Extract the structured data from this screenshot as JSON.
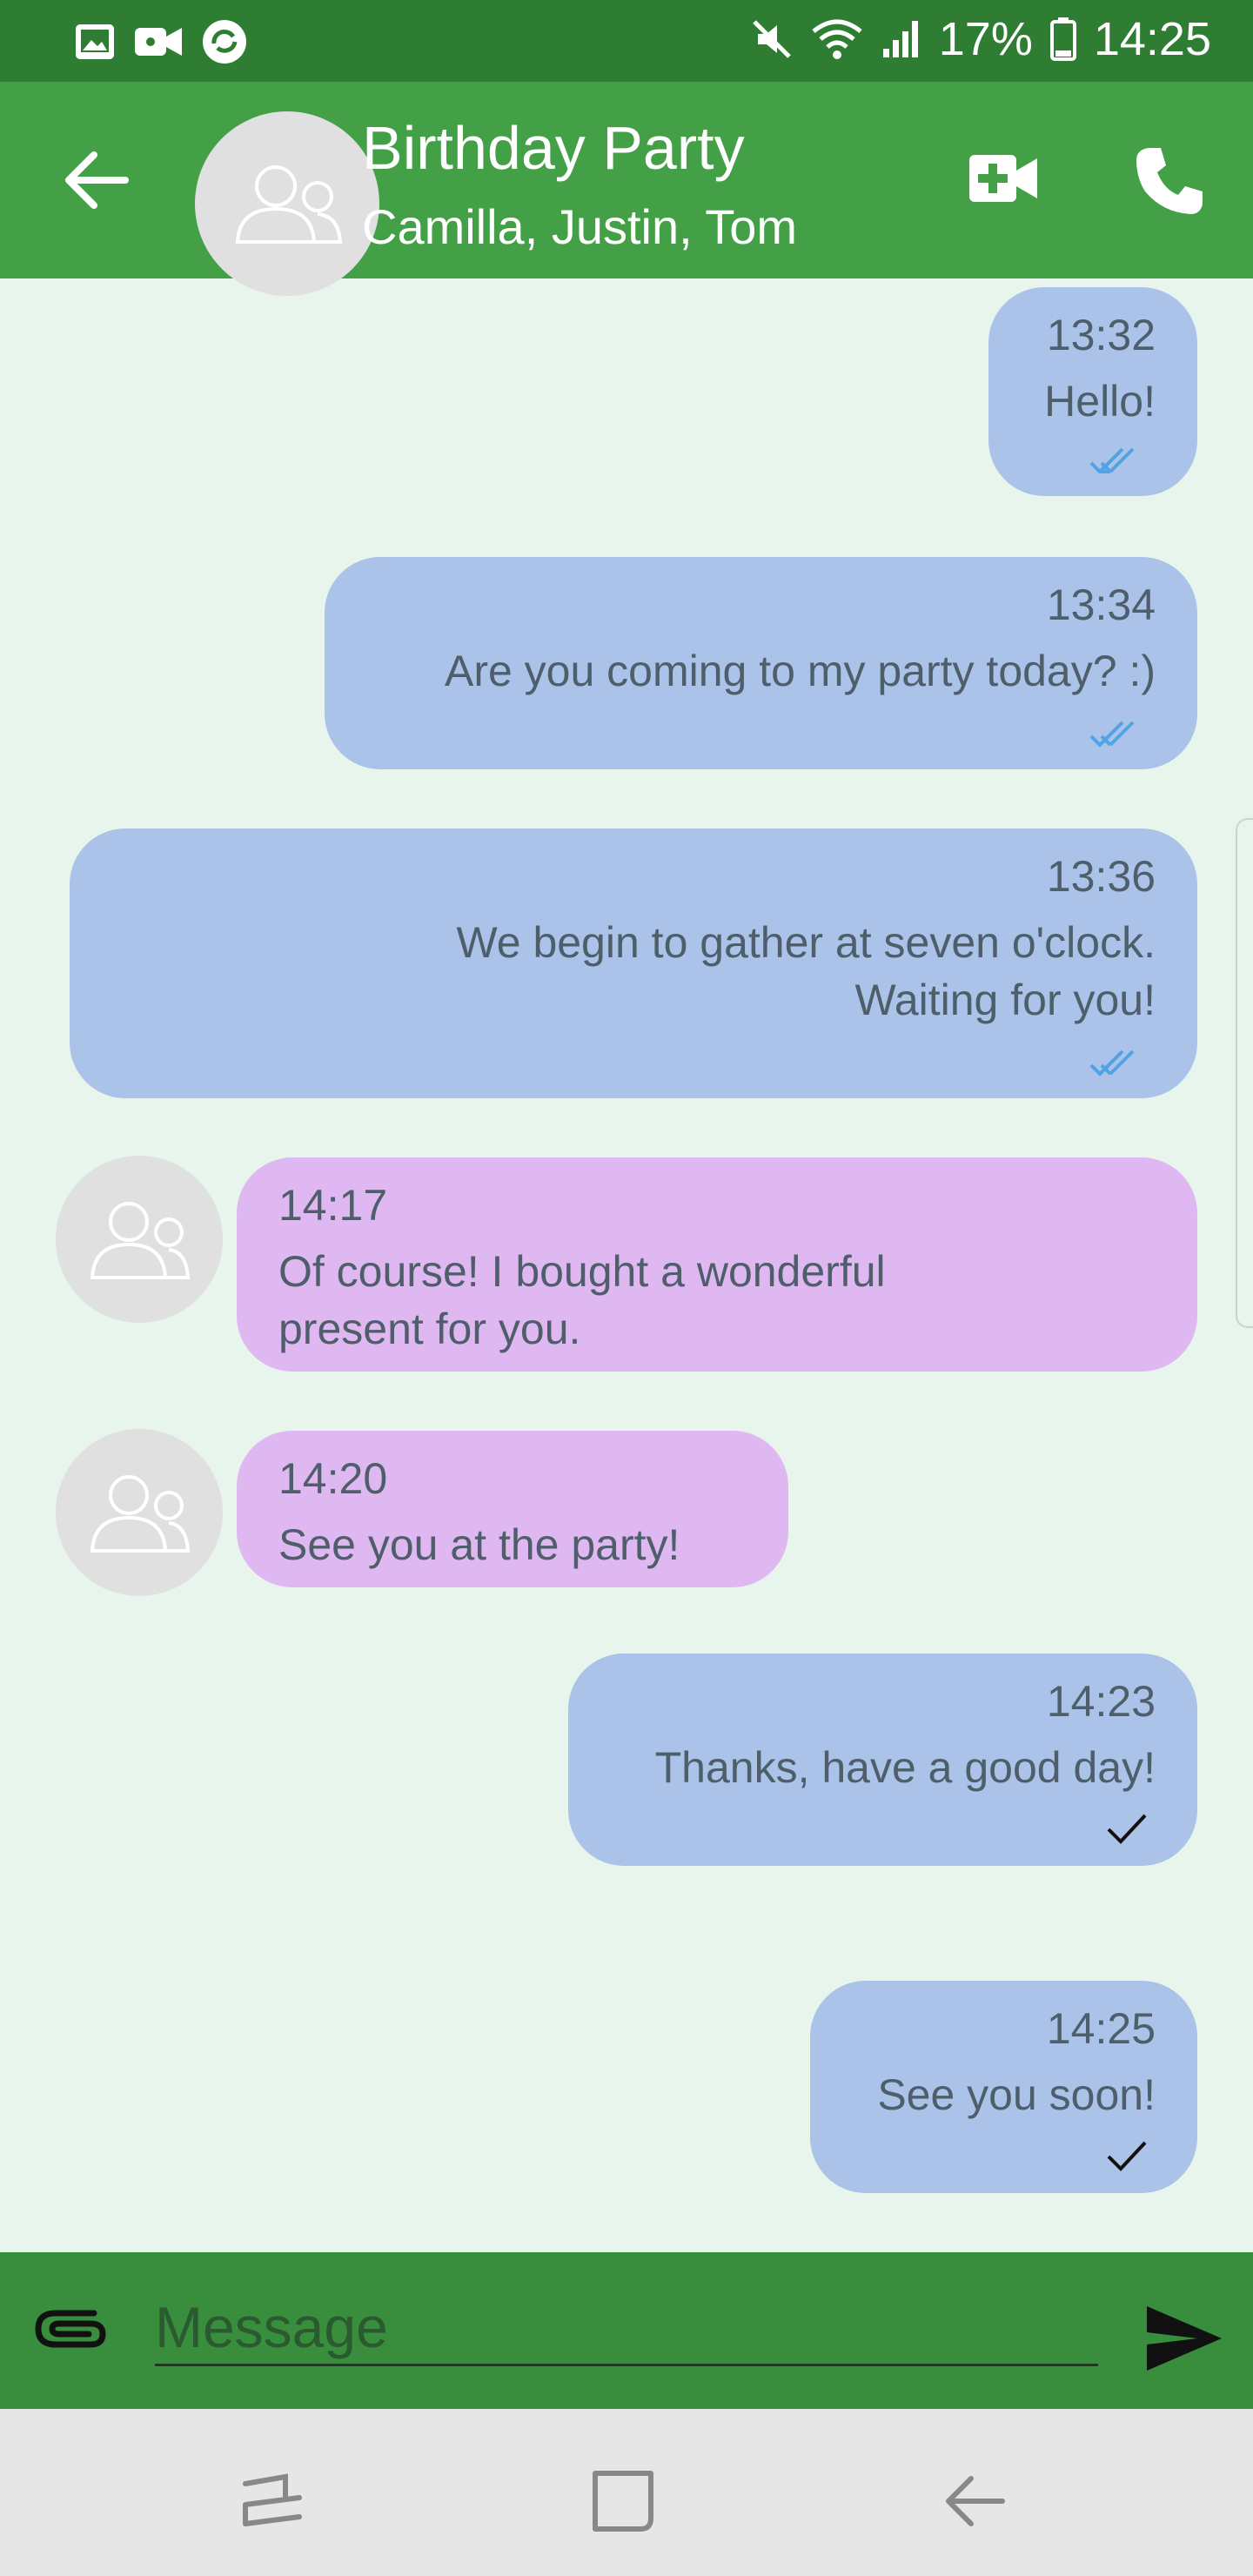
{
  "status_bar": {
    "battery": "17%",
    "time": "14:25",
    "icons": [
      "gallery-icon",
      "video-camera-icon",
      "sync-icon",
      "mute-icon",
      "wifi-icon",
      "signal-icon",
      "battery-icon"
    ]
  },
  "header": {
    "title": "Birthday Party",
    "subtitle": "Camilla, Justin, Tom",
    "icons": [
      "back-arrow-icon",
      "group-avatar-icon",
      "video-call-icon",
      "phone-icon"
    ]
  },
  "messages": [
    {
      "direction": "outgoing",
      "time": "13:32",
      "text": "Hello!",
      "status": "read"
    },
    {
      "direction": "outgoing",
      "time": "13:34",
      "text": "Are you coming to my party today? :)",
      "status": "read"
    },
    {
      "direction": "outgoing",
      "time": "13:36",
      "line1": "We begin to gather at seven o'clock.",
      "line2": "Waiting for you!",
      "status": "read"
    },
    {
      "direction": "incoming",
      "time": "14:17",
      "line1": "Of course! I bought a wonderful",
      "line2": "present for you."
    },
    {
      "direction": "incoming",
      "time": "14:20",
      "text": "See you at the party!"
    },
    {
      "direction": "outgoing",
      "time": "14:23",
      "text": "Thanks, have a good day!",
      "status": "sent"
    },
    {
      "direction": "outgoing",
      "time": "14:25",
      "text": "See you soon!",
      "status": "sent"
    }
  ],
  "composer": {
    "placeholder": "Message",
    "icons": [
      "attach-icon",
      "send-icon"
    ]
  },
  "nav": {
    "icons": [
      "recents-icon",
      "home-icon",
      "back-icon"
    ]
  },
  "colors": {
    "status_bar": "#2e7d32",
    "app_bar": "#43a047",
    "composer": "#388e3c",
    "background": "#e8f5ec",
    "outgoing_bubble": "#abc3e9",
    "incoming_bubble": "#e0b8f1",
    "read_tick": "#4fa3e6"
  }
}
